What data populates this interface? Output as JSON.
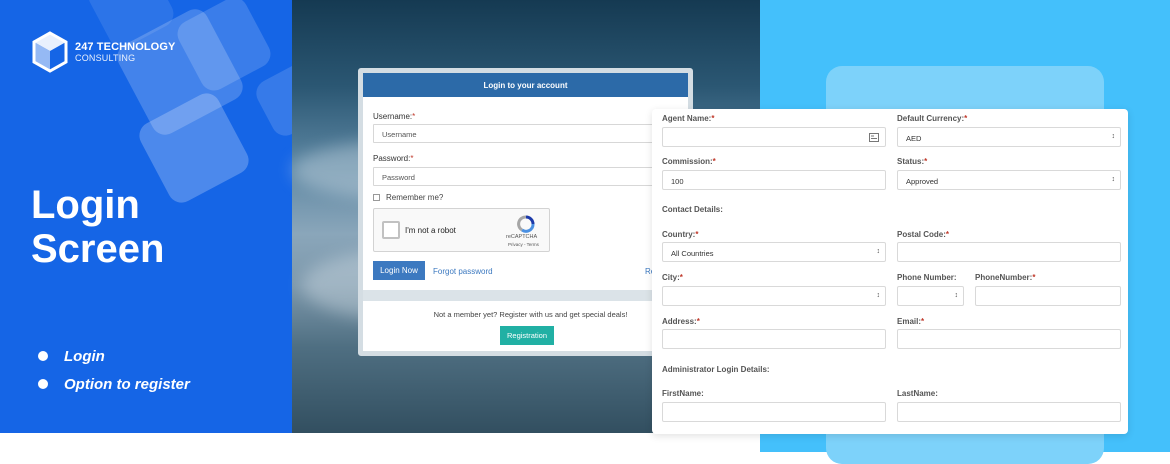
{
  "brand": {
    "title": "247 TECHNOLOGY",
    "subtitle": "CONSULTING"
  },
  "hero": {
    "line1": "Login",
    "line2": "Screen"
  },
  "features": [
    "Login",
    "Option to register"
  ],
  "login": {
    "header": "Login to your account",
    "username_label": "Username:",
    "username_placeholder": "Username",
    "password_label": "Password:",
    "password_placeholder": "Password",
    "remember_label": "Remember me?",
    "captcha_text": "I'm not a robot",
    "captcha_brand": "reCAPTCHA",
    "captcha_terms": "Privacy - Terms",
    "login_button": "Login Now",
    "forgot_link": "Forgot password",
    "register_link_partial": "Re",
    "member_text": "Not a member yet? Register with us and get special deals!",
    "registration_button": "Registration"
  },
  "agent_form": {
    "agent_name_label": "Agent Name:",
    "default_currency_label": "Default Currency:",
    "default_currency_value": "AED",
    "commission_label": "Commission:",
    "commission_value": "100",
    "status_label": "Status:",
    "status_value": "Approved",
    "contact_section": "Contact Details:",
    "country_label": "Country:",
    "country_value": "All Countries",
    "postal_code_label": "Postal Code:",
    "city_label": "City:",
    "phone_number_label": "Phone Number:",
    "phone_number2_label": "PhoneNumber:",
    "address_label": "Address:",
    "email_label": "Email:",
    "admin_section": "Administrator Login Details:",
    "first_name_label": "FirstName:",
    "last_name_label": "LastName:"
  },
  "colors": {
    "left_panel": "#1565e6",
    "login_header": "#2c6aa8",
    "login_button": "#3c79c0",
    "registration_button": "#21b0a4",
    "right_background": "#44c0fb",
    "required": "#c0392b"
  }
}
